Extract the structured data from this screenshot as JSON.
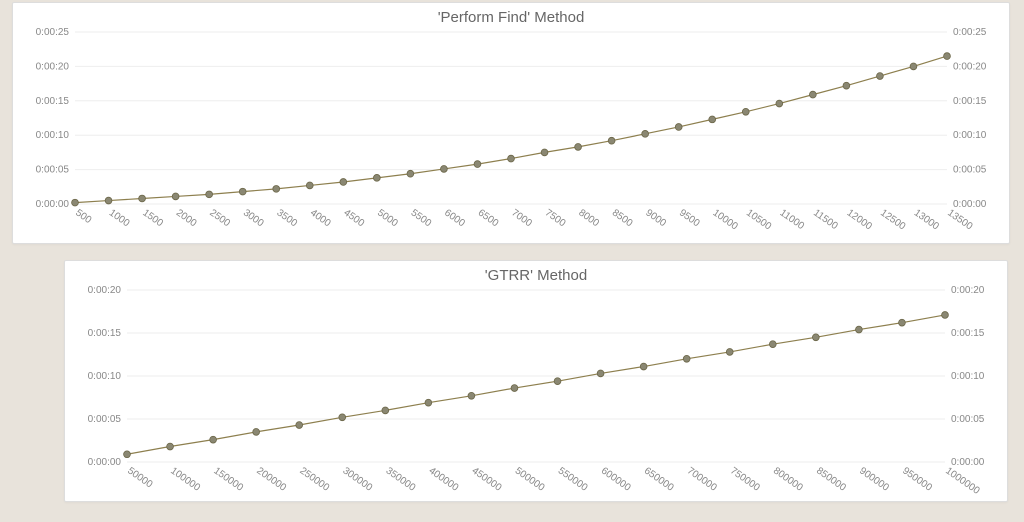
{
  "chart_data": [
    {
      "type": "line",
      "title": "'Perform Find' Method",
      "xlabel": "",
      "ylabel": "",
      "y_format": "h:mm:ss",
      "y_ticks_seconds": [
        0,
        5,
        10,
        15,
        20,
        25
      ],
      "y_tick_labels": [
        "0:00:00",
        "0:00:05",
        "0:00:10",
        "0:00:15",
        "0:00:20",
        "0:00:25"
      ],
      "ylim": [
        0,
        25
      ],
      "x": [
        500,
        1000,
        1500,
        2000,
        2500,
        3000,
        3500,
        4000,
        4500,
        5000,
        5500,
        6000,
        6500,
        7000,
        7500,
        8000,
        8500,
        9000,
        9500,
        10000,
        10500,
        11000,
        11500,
        12000,
        12500,
        13000,
        13500
      ],
      "x_tick_labels": [
        "500",
        "1000",
        "1500",
        "2000",
        "2500",
        "3000",
        "3500",
        "4000",
        "4500",
        "5000",
        "5500",
        "6000",
        "6500",
        "7000",
        "7500",
        "8000",
        "8500",
        "9000",
        "9500",
        "10000",
        "10500",
        "11000",
        "11500",
        "12000",
        "12500",
        "13000",
        "13500"
      ],
      "values_seconds": [
        0.2,
        0.5,
        0.8,
        1.1,
        1.4,
        1.8,
        2.2,
        2.7,
        3.2,
        3.8,
        4.4,
        5.1,
        5.8,
        6.6,
        7.5,
        8.3,
        9.2,
        10.2,
        11.2,
        12.3,
        13.4,
        14.6,
        15.9,
        17.2,
        18.6,
        20.0,
        21.5
      ]
    },
    {
      "type": "line",
      "title": "'GTRR' Method",
      "xlabel": "",
      "ylabel": "",
      "y_format": "h:mm:ss",
      "y_ticks_seconds": [
        0,
        5,
        10,
        15,
        20
      ],
      "y_tick_labels": [
        "0:00:00",
        "0:00:05",
        "0:00:10",
        "0:00:15",
        "0:00:20"
      ],
      "ylim": [
        0,
        20
      ],
      "x": [
        50000,
        100000,
        150000,
        200000,
        250000,
        300000,
        350000,
        400000,
        450000,
        500000,
        550000,
        600000,
        650000,
        700000,
        750000,
        800000,
        850000,
        900000,
        950000,
        1000000
      ],
      "x_tick_labels": [
        "50000",
        "100000",
        "150000",
        "200000",
        "250000",
        "300000",
        "350000",
        "400000",
        "450000",
        "500000",
        "550000",
        "600000",
        "650000",
        "700000",
        "750000",
        "800000",
        "850000",
        "900000",
        "950000",
        "1000000"
      ],
      "values_seconds": [
        0.9,
        1.8,
        2.6,
        3.5,
        4.3,
        5.2,
        6.0,
        6.9,
        7.7,
        8.6,
        9.4,
        10.3,
        11.1,
        12.0,
        12.8,
        13.7,
        14.5,
        15.4,
        16.2,
        17.1
      ]
    }
  ]
}
